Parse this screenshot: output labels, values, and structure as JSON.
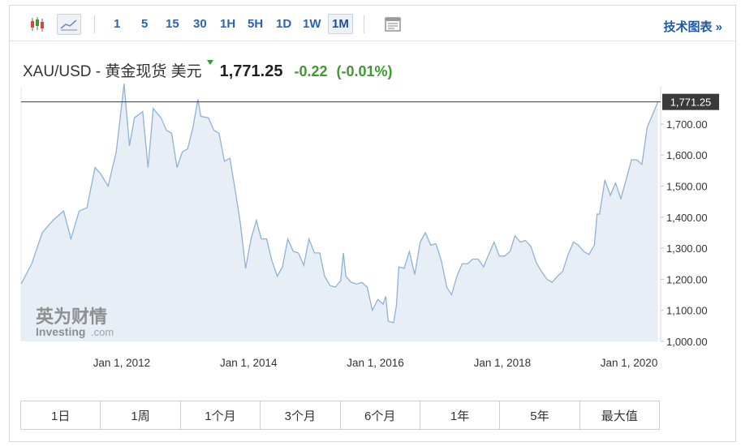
{
  "toolbar": {
    "icons": [
      {
        "name": "candlestick-chart-icon"
      },
      {
        "name": "area-chart-icon",
        "active": true
      },
      {
        "name": "table-view-icon"
      }
    ],
    "periods": [
      "1",
      "5",
      "15",
      "30",
      "1H",
      "5H",
      "1D",
      "1W",
      "1M"
    ],
    "selected_period": "1M",
    "tech_label": "技术图表 »"
  },
  "quote": {
    "symbol": "XAU/USD - 黄金现货 美元",
    "price": "1,771.25",
    "change": "-0.22",
    "change_pct": "(-0.01%)",
    "up_color": "#3d9a2e"
  },
  "watermark": {
    "brand_cn": "英为财情",
    "brand_en": "Investing",
    "brand_suffix": ".com"
  },
  "range_buttons": [
    "1日",
    "1周",
    "1个月",
    "3个月",
    "6个月",
    "1年",
    "5年",
    "最大值"
  ],
  "chart_data": {
    "type": "area",
    "title": "",
    "xlabel": "",
    "ylabel": "",
    "current_value": 1771.25,
    "current_value_label": "1,771.25",
    "ylim": [
      1000,
      1820
    ],
    "y_ticks": [
      1000,
      1100,
      1200,
      1300,
      1400,
      1500,
      1600,
      1700
    ],
    "y_tick_labels": [
      "1,000.00",
      "1,100.00",
      "1,200.00",
      "1,300.00",
      "1,400.00",
      "1,500.00",
      "1,600.00",
      "1,700.00"
    ],
    "x_tick_labels": [
      "Jan 1, 2012",
      "Jan 1, 2014",
      "Jan 1, 2016",
      "Jan 1, 2018",
      "Jan 1, 2020"
    ],
    "x_ticks": [
      "2012-01-01",
      "2014-01-01",
      "2016-01-01",
      "2018-01-01",
      "2020-01-01"
    ],
    "x_range": [
      "2010-06-01",
      "2020-07-01"
    ],
    "line_color": "#8fb2d6",
    "fill_color": "#e8eef6",
    "series": [
      {
        "points": [
          [
            "2010-06-01",
            1185
          ],
          [
            "2010-08-01",
            1250
          ],
          [
            "2010-10-01",
            1350
          ],
          [
            "2010-12-01",
            1390
          ],
          [
            "2011-02-01",
            1420
          ],
          [
            "2011-03-15",
            1330
          ],
          [
            "2011-05-01",
            1420
          ],
          [
            "2011-06-15",
            1430
          ],
          [
            "2011-08-01",
            1560
          ],
          [
            "2011-09-01",
            1540
          ],
          [
            "2011-10-15",
            1500
          ],
          [
            "2011-12-01",
            1610
          ],
          [
            "2012-01-15",
            1830
          ],
          [
            "2012-02-15",
            1630
          ],
          [
            "2012-03-15",
            1720
          ],
          [
            "2012-05-01",
            1740
          ],
          [
            "2012-06-01",
            1560
          ],
          [
            "2012-07-01",
            1750
          ],
          [
            "2012-08-15",
            1720
          ],
          [
            "2012-09-15",
            1680
          ],
          [
            "2012-10-15",
            1670
          ],
          [
            "2012-11-15",
            1560
          ],
          [
            "2012-12-15",
            1610
          ],
          [
            "2013-01-15",
            1620
          ],
          [
            "2013-02-15",
            1690
          ],
          [
            "2013-03-15",
            1780
          ],
          [
            "2013-04-01",
            1725
          ],
          [
            "2013-05-15",
            1720
          ],
          [
            "2013-06-15",
            1680
          ],
          [
            "2013-07-15",
            1670
          ],
          [
            "2013-08-15",
            1580
          ],
          [
            "2013-09-15",
            1590
          ],
          [
            "2013-10-15",
            1490
          ],
          [
            "2013-11-15",
            1380
          ],
          [
            "2013-12-15",
            1235
          ],
          [
            "2014-01-15",
            1330
          ],
          [
            "2014-02-15",
            1390
          ],
          [
            "2014-03-15",
            1330
          ],
          [
            "2014-04-15",
            1330
          ],
          [
            "2014-05-15",
            1260
          ],
          [
            "2014-06-15",
            1210
          ],
          [
            "2014-07-15",
            1240
          ],
          [
            "2014-08-15",
            1330
          ],
          [
            "2014-09-15",
            1290
          ],
          [
            "2014-10-15",
            1285
          ],
          [
            "2014-11-15",
            1245
          ],
          [
            "2014-12-15",
            1330
          ],
          [
            "2015-01-15",
            1285
          ],
          [
            "2015-02-15",
            1285
          ],
          [
            "2015-03-15",
            1210
          ],
          [
            "2015-04-15",
            1180
          ],
          [
            "2015-05-15",
            1175
          ],
          [
            "2015-06-15",
            1195
          ],
          [
            "2015-07-01",
            1285
          ],
          [
            "2015-07-15",
            1210
          ],
          [
            "2015-08-15",
            1190
          ],
          [
            "2015-09-15",
            1185
          ],
          [
            "2015-10-15",
            1190
          ],
          [
            "2015-11-15",
            1175
          ],
          [
            "2015-12-15",
            1100
          ],
          [
            "2016-01-15",
            1135
          ],
          [
            "2016-02-15",
            1120
          ],
          [
            "2016-03-01",
            1145
          ],
          [
            "2016-03-15",
            1065
          ],
          [
            "2016-04-15",
            1060
          ],
          [
            "2016-05-01",
            1115
          ],
          [
            "2016-05-15",
            1240
          ],
          [
            "2016-06-15",
            1235
          ],
          [
            "2016-07-15",
            1290
          ],
          [
            "2016-08-15",
            1215
          ],
          [
            "2016-09-15",
            1320
          ],
          [
            "2016-10-15",
            1350
          ],
          [
            "2016-11-15",
            1310
          ],
          [
            "2016-12-15",
            1315
          ],
          [
            "2017-01-15",
            1260
          ],
          [
            "2017-02-15",
            1175
          ],
          [
            "2017-03-15",
            1150
          ],
          [
            "2017-04-15",
            1210
          ],
          [
            "2017-05-15",
            1250
          ],
          [
            "2017-06-15",
            1250
          ],
          [
            "2017-07-15",
            1265
          ],
          [
            "2017-08-15",
            1265
          ],
          [
            "2017-09-15",
            1240
          ],
          [
            "2017-10-15",
            1280
          ],
          [
            "2017-11-15",
            1320
          ],
          [
            "2017-12-15",
            1275
          ],
          [
            "2018-01-15",
            1275
          ],
          [
            "2018-02-15",
            1290
          ],
          [
            "2018-03-15",
            1340
          ],
          [
            "2018-04-15",
            1320
          ],
          [
            "2018-05-15",
            1325
          ],
          [
            "2018-06-15",
            1305
          ],
          [
            "2018-07-15",
            1255
          ],
          [
            "2018-08-15",
            1225
          ],
          [
            "2018-09-15",
            1200
          ],
          [
            "2018-10-15",
            1190
          ],
          [
            "2018-11-15",
            1210
          ],
          [
            "2018-12-15",
            1225
          ],
          [
            "2019-01-15",
            1280
          ],
          [
            "2019-02-15",
            1320
          ],
          [
            "2019-03-15",
            1310
          ],
          [
            "2019-04-15",
            1290
          ],
          [
            "2019-05-15",
            1280
          ],
          [
            "2019-06-15",
            1310
          ],
          [
            "2019-07-01",
            1410
          ],
          [
            "2019-07-15",
            1410
          ],
          [
            "2019-08-15",
            1520
          ],
          [
            "2019-09-15",
            1470
          ],
          [
            "2019-10-15",
            1510
          ],
          [
            "2019-11-15",
            1460
          ],
          [
            "2019-12-15",
            1520
          ],
          [
            "2020-01-15",
            1585
          ],
          [
            "2020-02-15",
            1585
          ],
          [
            "2020-03-15",
            1570
          ],
          [
            "2020-04-15",
            1690
          ],
          [
            "2020-05-15",
            1730
          ],
          [
            "2020-06-15",
            1771.25
          ]
        ]
      }
    ]
  }
}
